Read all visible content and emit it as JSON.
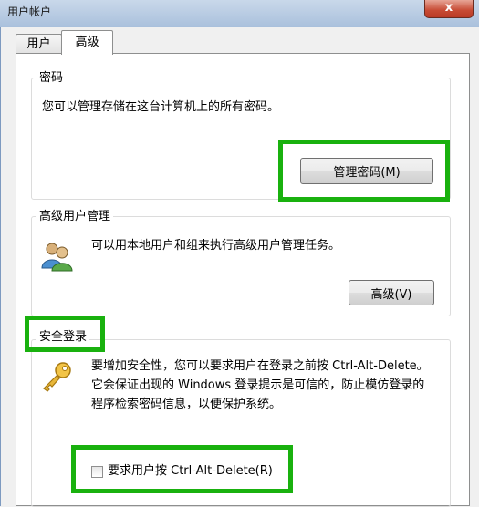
{
  "window": {
    "title": "用户帐户",
    "close_glyph": "x"
  },
  "tabs": [
    {
      "label": "用户"
    },
    {
      "label": "高级"
    }
  ],
  "passwords": {
    "title": "密码",
    "description": "您可以管理存储在这台计算机上的所有密码。",
    "button_label": "管理密码(M)"
  },
  "advanced_users": {
    "title": "高级用户管理",
    "description": "可以用本地用户和组来执行高级用户管理任务。",
    "button_label": "高级(V)",
    "icon": "users-group-icon"
  },
  "secure_logon": {
    "title": "安全登录",
    "description_lines": [
      "要增加安全性，您可以要求用户在登录之前按 Ctrl-Alt-Delete。",
      "它会保证出现的 Windows 登录提示是可信的，防止模仿登录的",
      "程序检索密码信息，以便保护系统。"
    ],
    "icon": "key-icon",
    "checkbox_label": "要求用户按 Ctrl-Alt-Delete(R)",
    "checkbox_checked": false
  },
  "colors": {
    "highlight": "#19b10e"
  }
}
